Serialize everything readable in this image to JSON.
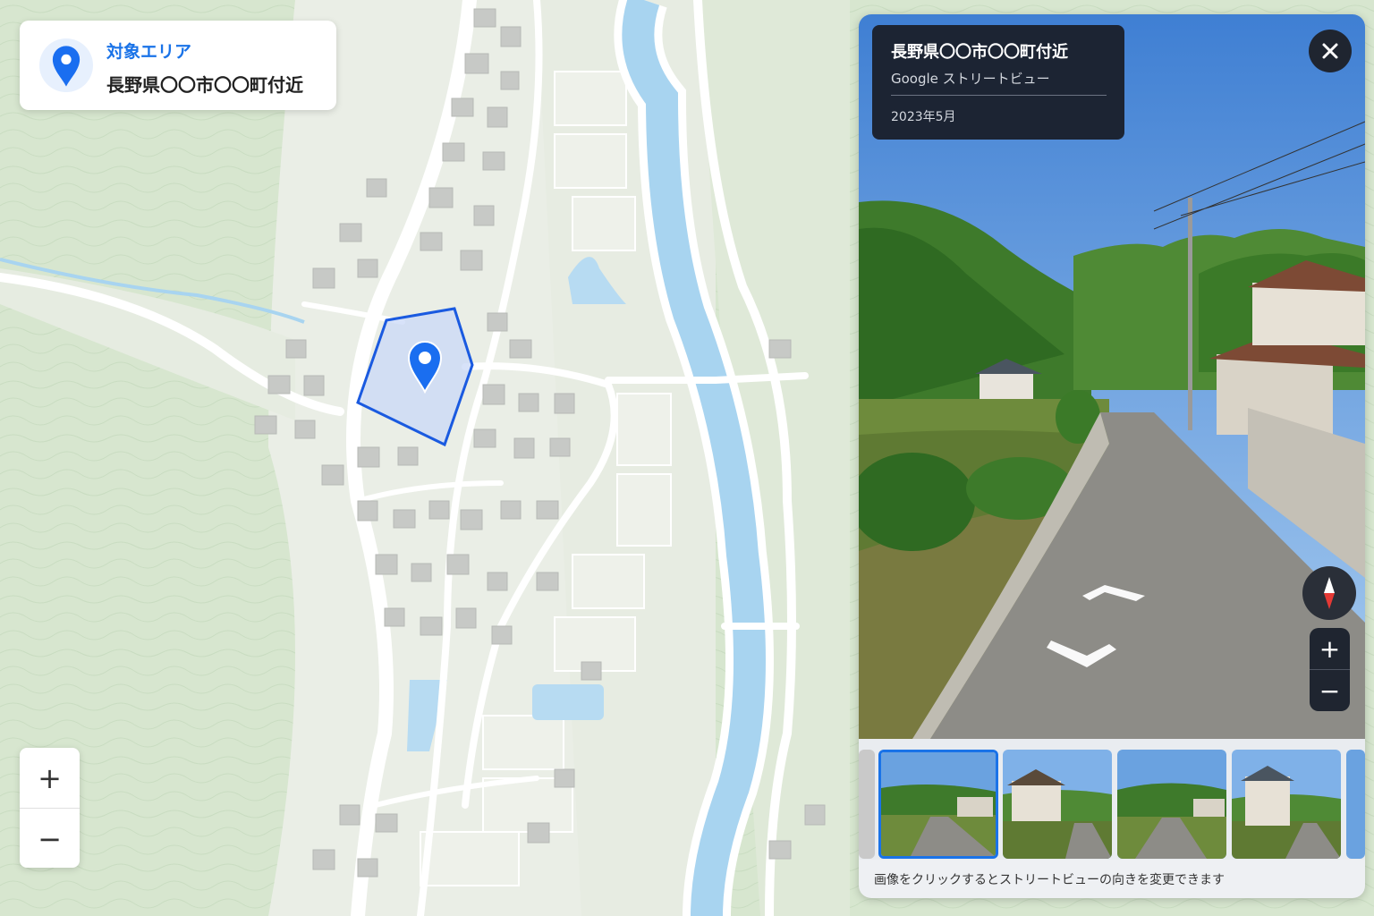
{
  "area_card": {
    "label": "対象エリア",
    "name": "長野県〇〇市〇〇町付近",
    "icon": "location-pin-icon"
  },
  "map_zoom": {
    "zoom_in": "+",
    "zoom_out": "−"
  },
  "street_view": {
    "title": "長野県〇〇市〇〇町付近",
    "source": "Google ストリートビュー",
    "date": "2023年5月",
    "close_icon": "close-icon",
    "compass_icon": "compass-icon",
    "zoom_in": "+",
    "zoom_out": "−",
    "caption": "画像をクリックするとストリートビューの向きを変更できます",
    "thumbnails": [
      "thumb-1",
      "thumb-2",
      "thumb-3",
      "thumb-4"
    ],
    "selected_thumbnail": 1
  },
  "colors": {
    "accent": "#1a73e8",
    "area_fill": "#c9d8f7",
    "river": "#a8d4f0",
    "forest": "#cfe3c6",
    "panel_dark": "#1c2433"
  }
}
